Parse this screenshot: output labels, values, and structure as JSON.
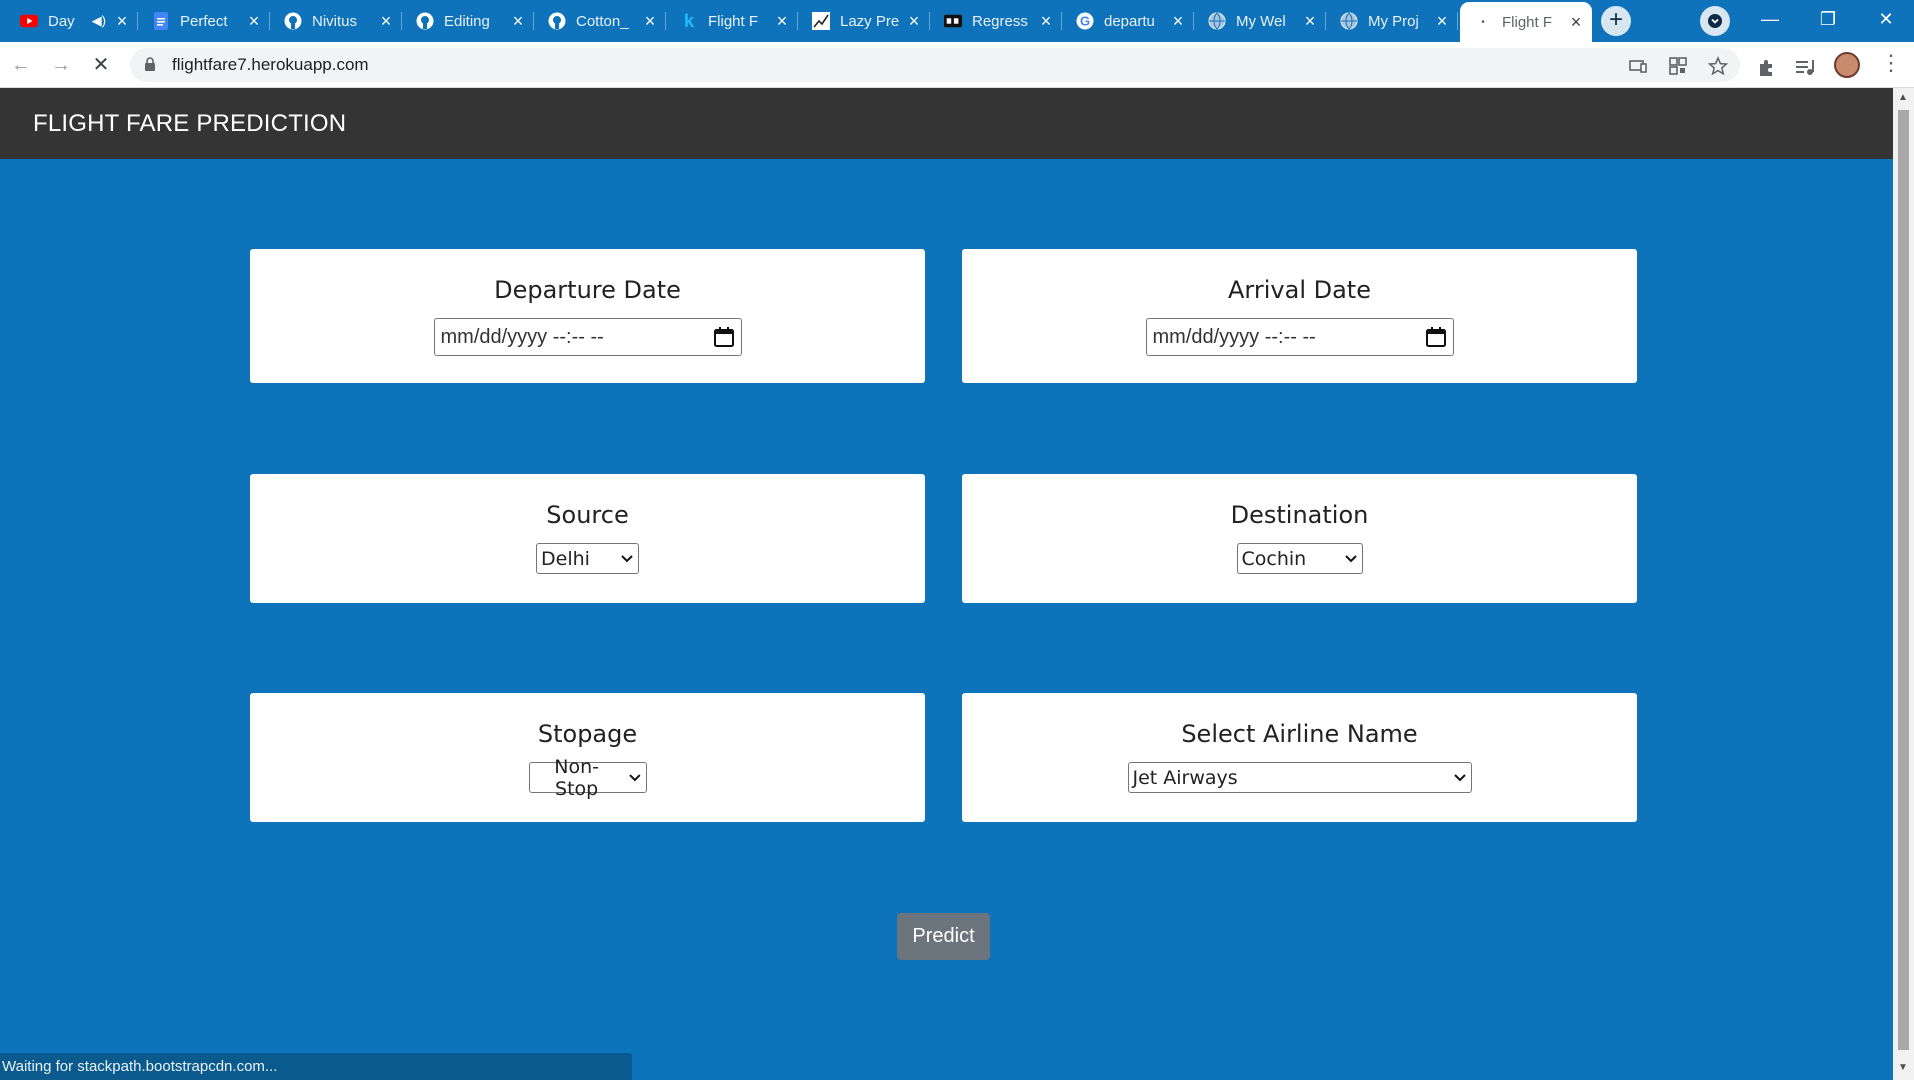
{
  "browser": {
    "tabs": [
      {
        "title": "Day",
        "icon": "youtube-icon"
      },
      {
        "title": "Perfect",
        "icon": "docs-icon"
      },
      {
        "title": "Nivitus",
        "icon": "github-icon"
      },
      {
        "title": "Editing",
        "icon": "github-icon"
      },
      {
        "title": "Cotton_",
        "icon": "github-icon"
      },
      {
        "title": "Flight F",
        "icon": "kaggle-icon"
      },
      {
        "title": "Lazy Pre",
        "icon": "chart-icon"
      },
      {
        "title": "Regress",
        "icon": "video-icon"
      },
      {
        "title": "departu",
        "icon": "google-icon"
      },
      {
        "title": "My Wel",
        "icon": "globe-icon"
      },
      {
        "title": "My Proj",
        "icon": "globe-icon"
      },
      {
        "title": "Flight F",
        "icon": "loading-icon"
      }
    ],
    "new_tab_label": "+",
    "url": "flightfare7.herokuapp.com",
    "status_text": "Waiting for stackpath.bootstrapcdn.com..."
  },
  "page": {
    "brand": "FLIGHT FARE PREDICTION",
    "departure": {
      "label": "Departure Date",
      "placeholder": "mm/dd/yyyy --:-- --"
    },
    "arrival": {
      "label": "Arrival Date",
      "placeholder": "mm/dd/yyyy --:-- --"
    },
    "source": {
      "label": "Source",
      "selected": "Delhi"
    },
    "destination": {
      "label": "Destination",
      "selected": "Cochin"
    },
    "stopage": {
      "label": "Stopage",
      "selected": "Non-Stop"
    },
    "airline": {
      "label": "Select Airline Name",
      "selected": "Jet Airways"
    },
    "predict_label": "Predict"
  },
  "colors": {
    "page_background": "#0d73bb",
    "navbar": "#343435",
    "button": "#6c757d"
  }
}
